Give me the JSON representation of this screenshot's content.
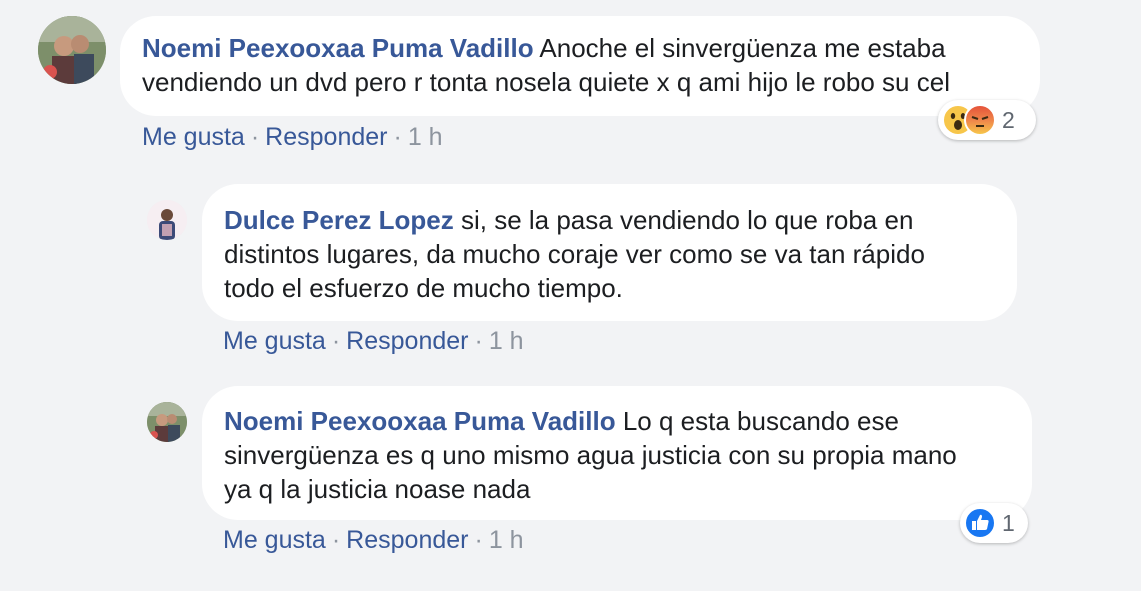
{
  "colors": {
    "background": "#f2f3f5",
    "bubble": "#ffffff",
    "author": "#385898",
    "text": "#1c1e21",
    "meta": "#8d949e"
  },
  "comments": [
    {
      "author": "Noemi Peexooxaa Puma Vadillo",
      "text_line1": "Anoche el sinvergüenza me estaba",
      "text_line2": "vendiendo un dvd pero r tonta nosela quiete x q ami hijo le robo su cel",
      "like": "Me gusta",
      "reply": "Responder",
      "time": "1 h",
      "reactions": {
        "icons": [
          "wow-icon",
          "angry-icon"
        ],
        "count": "2"
      }
    },
    {
      "author": "Dulce Perez Lopez",
      "text_line1": "si, se la pasa vendiendo lo que roba en",
      "text_line2": "distintos lugares, da mucho coraje ver como se va tan rápido",
      "text_line3": "todo el esfuerzo de mucho tiempo.",
      "like": "Me gusta",
      "reply": "Responder",
      "time": "1 h"
    },
    {
      "author": "Noemi Peexooxaa Puma Vadillo",
      "text_line1": "Lo q esta buscando ese",
      "text_line2": "sinvergüenza es q uno mismo agua justicia con su propia mano",
      "text_line3": "ya q la justicia noase nada",
      "like": "Me gusta",
      "reply": "Responder",
      "time": "1 h",
      "reactions": {
        "icons": [
          "like-icon"
        ],
        "count": "1"
      }
    }
  ],
  "separator": "·"
}
